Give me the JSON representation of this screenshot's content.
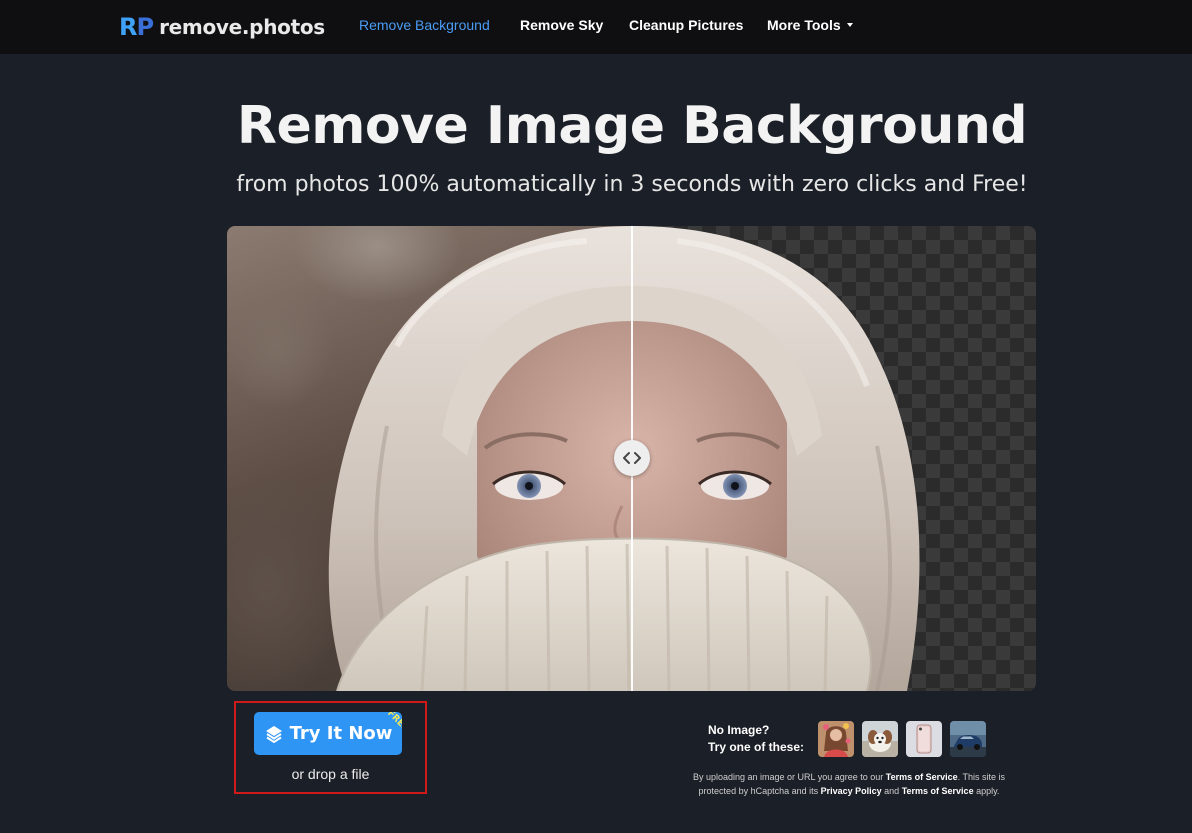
{
  "nav": {
    "logo_mark": "RP",
    "logo_text": "remove.photos",
    "links": [
      "Remove Background",
      "Remove Sky",
      "Cleanup Pictures",
      "More Tools"
    ]
  },
  "hero": {
    "title": "Remove Image Background",
    "subtitle": "from photos 100% automatically in 3 seconds with zero clicks and Free!"
  },
  "cta": {
    "button_label": "Try It Now",
    "badge": "FREE",
    "drop_text": "or drop a file"
  },
  "samples": {
    "line1": "No Image?",
    "line2": "Try one of these:"
  },
  "legal": {
    "t1": "By uploading an image or URL you agree to our ",
    "tos": "Terms of Service",
    "t2": ". This site is protected by hCaptcha and its ",
    "privacy": "Privacy Policy",
    "t3": " and ",
    "tos2": "Terms of Service",
    "t4": " apply."
  },
  "colors": {
    "accent": "#2e95f5",
    "nav_active": "#4a9cf5",
    "background": "#1b1f27",
    "highlight_border": "#d01a1a"
  }
}
